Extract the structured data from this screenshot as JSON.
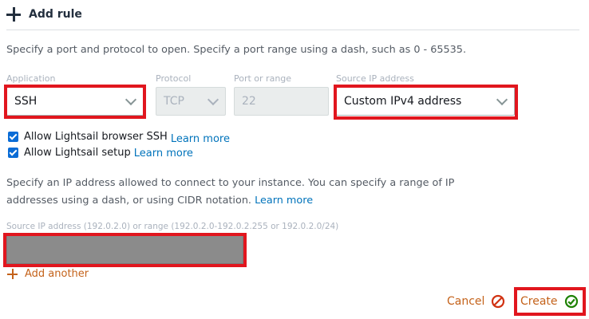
{
  "header": {
    "title": "Add rule",
    "icon": "plus-icon"
  },
  "intro": "Specify a port and protocol to open. Specify a port range using a dash, such as 0 - 65535.",
  "fields": {
    "application": {
      "label": "Application",
      "value": "SSH"
    },
    "protocol": {
      "label": "Protocol",
      "value": "TCP"
    },
    "port": {
      "label": "Port or range",
      "value": "22"
    },
    "source": {
      "label": "Source IP address",
      "value": "Custom IPv4 address"
    }
  },
  "checkboxes": [
    {
      "label": "Allow Lightsail browser SSH",
      "link": "Learn more",
      "checked": true
    },
    {
      "label": "Allow Lightsail setup",
      "link": "Learn more",
      "checked": true
    }
  ],
  "description": {
    "text": "Specify an IP address allowed to connect to your instance. You can specify a range of IP addresses using a dash, or using CIDR notation.",
    "link": "Learn more"
  },
  "source_input": {
    "label": "Source IP address (192.0.2.0) or range (192.0.2.0-192.0.2.255 or 192.0.2.0/24)",
    "value": ""
  },
  "add_another": "Add another",
  "actions": {
    "cancel": "Cancel",
    "create": "Create"
  },
  "colors": {
    "accent": "#c4621a",
    "link": "#0073bb",
    "highlight": "#e1161e",
    "confirm": "#1d8102"
  }
}
